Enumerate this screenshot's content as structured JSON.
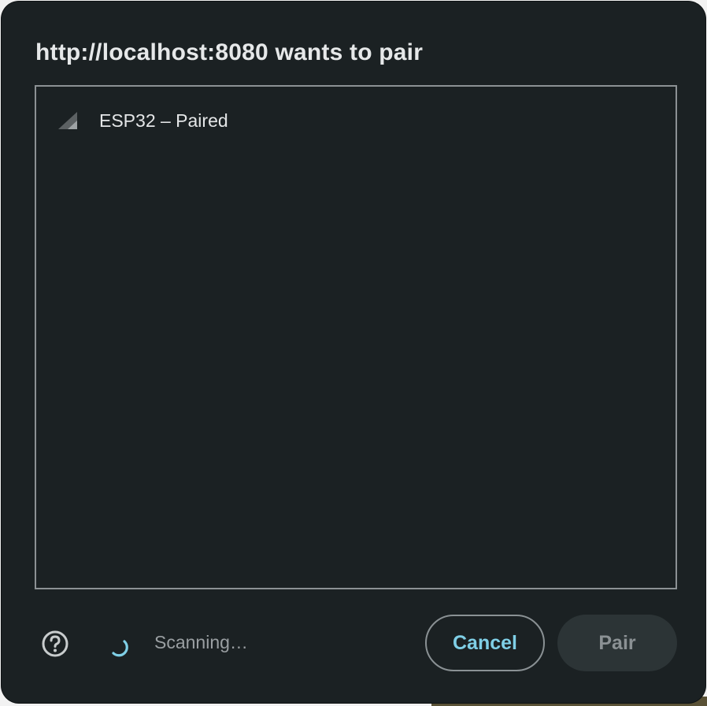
{
  "dialog": {
    "title": "http://localhost:8080 wants to pair"
  },
  "devices": [
    {
      "label": "ESP32 – Paired",
      "icon": "signal-strength-icon"
    }
  ],
  "footer": {
    "help_icon": "help-circle-icon",
    "spinner_icon": "loading-spinner-icon",
    "status": "Scanning…",
    "cancel_label": "Cancel",
    "pair_label": "Pair"
  },
  "colors": {
    "dialog_bg": "#1b2123",
    "accent": "#7fcfe6",
    "text": "#e4e6e7",
    "muted_text": "#9a9fa2",
    "border": "#8c9194",
    "disabled_button_bg": "#2c3436"
  }
}
